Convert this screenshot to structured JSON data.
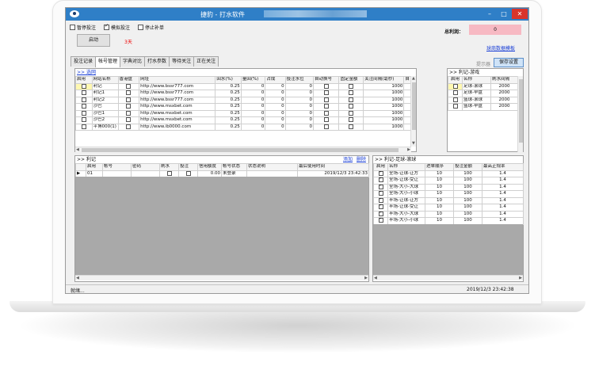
{
  "window": {
    "title": "捷豹 - 打水软件"
  },
  "options": {
    "pause_bet": "暂停投注",
    "sim_bet": "模拟投注",
    "stop_rebet": "停止补单"
  },
  "start": {
    "button": "启动",
    "days": "3天"
  },
  "profit": {
    "label": "总利润：",
    "value": "0"
  },
  "template_link": "球商数据模板",
  "tabs": [
    "投注记录",
    "帐号管理",
    "字典对比",
    "打水参数",
    "等待关注",
    "正在关注"
  ],
  "hint": "提示器",
  "save_button": "保存设置",
  "sites": {
    "header": ">> 选网",
    "columns": [
      "启用",
      "网站名称",
      "香港盘",
      "网址",
      "回水(%)",
      "量回(%)",
      "占成",
      "投注水位",
      "自动换号",
      "固定金额",
      "关注间隔(毫秒)",
      "自"
    ],
    "rows": [
      {
        "name": "利记",
        "url": "http://www.bssr777.com",
        "rebate": "0.25",
        "vol": "0",
        "share": "0",
        "level": "0",
        "amount": "1000"
      },
      {
        "name": "利记1",
        "url": "http://www.bssr777.com",
        "rebate": "0.25",
        "vol": "0",
        "share": "0",
        "level": "0",
        "amount": "1000"
      },
      {
        "name": "利记2",
        "url": "http://www.bssr777.com",
        "rebate": "0.25",
        "vol": "0",
        "share": "0",
        "level": "0",
        "amount": "1000"
      },
      {
        "name": "沙巴",
        "url": "http://www.msxbet.com",
        "rebate": "0.25",
        "vol": "0",
        "share": "0",
        "level": "0",
        "amount": "1000"
      },
      {
        "name": "沙巴1",
        "url": "http://www.msxbet.com",
        "rebate": "0.25",
        "vol": "0",
        "share": "0",
        "level": "0",
        "amount": "1000"
      },
      {
        "name": "沙巴2",
        "url": "http://www.msxbet.com",
        "rebate": "0.25",
        "vol": "0",
        "share": "0",
        "level": "0",
        "amount": "1000"
      },
      {
        "name": "平博000(1)",
        "url": "http://www.ib0000.com",
        "rebate": "0.25",
        "vol": "0",
        "share": "0",
        "level": "0",
        "amount": "1000"
      }
    ]
  },
  "games": {
    "header": ">> 利记-游戏",
    "columns": [
      "启用",
      "名称",
      "刷水间隔"
    ],
    "rows": [
      {
        "name": "足球-滚球",
        "interval": "2000",
        "checked": false,
        "yellow": true
      },
      {
        "name": "足球-早盘",
        "interval": "2000",
        "checked": false,
        "yellow": false
      },
      {
        "name": "篮球-滚球",
        "interval": "2000",
        "checked": false,
        "yellow": false
      },
      {
        "name": "篮球-早盘",
        "interval": "2000",
        "checked": false,
        "yellow": false
      }
    ]
  },
  "accounts": {
    "header": ">> 利记",
    "add": "添加",
    "delete": "删除",
    "columns": [
      "启用",
      "帐号",
      "密码",
      "刷水",
      "投注",
      "信用额度",
      "帐号状态",
      "状态说明",
      "最后使用时间"
    ],
    "rows": [
      {
        "id": "01",
        "credit": "0.00",
        "status": "未登录",
        "note": "",
        "last_used": "2019/12/3 23:42:33"
      }
    ]
  },
  "plays": {
    "header": ">> 利记-足球-滚球",
    "columns": [
      "启用",
      "名称",
      "进单顺序",
      "投注金额",
      "最高正规率"
    ],
    "rows": [
      {
        "name": "全场-让球-让方",
        "order": "10",
        "amount": "100",
        "rate": "1.4"
      },
      {
        "name": "全场-让球-受让",
        "order": "10",
        "amount": "100",
        "rate": "1.4"
      },
      {
        "name": "全场-大小-大球",
        "order": "10",
        "amount": "100",
        "rate": "1.4"
      },
      {
        "name": "全场-大小-小球",
        "order": "10",
        "amount": "100",
        "rate": "1.4"
      },
      {
        "name": "半场-让球-让方",
        "order": "10",
        "amount": "100",
        "rate": "1.4"
      },
      {
        "name": "半场-让球-受让",
        "order": "10",
        "amount": "100",
        "rate": "1.4"
      },
      {
        "name": "半场-大小-大球",
        "order": "10",
        "amount": "100",
        "rate": "1.4"
      },
      {
        "name": "半场-大小-小球",
        "order": "10",
        "amount": "100",
        "rate": "1.4"
      }
    ]
  },
  "status": {
    "left": "就绪...",
    "right": "2019/12/3 23:42:38"
  }
}
